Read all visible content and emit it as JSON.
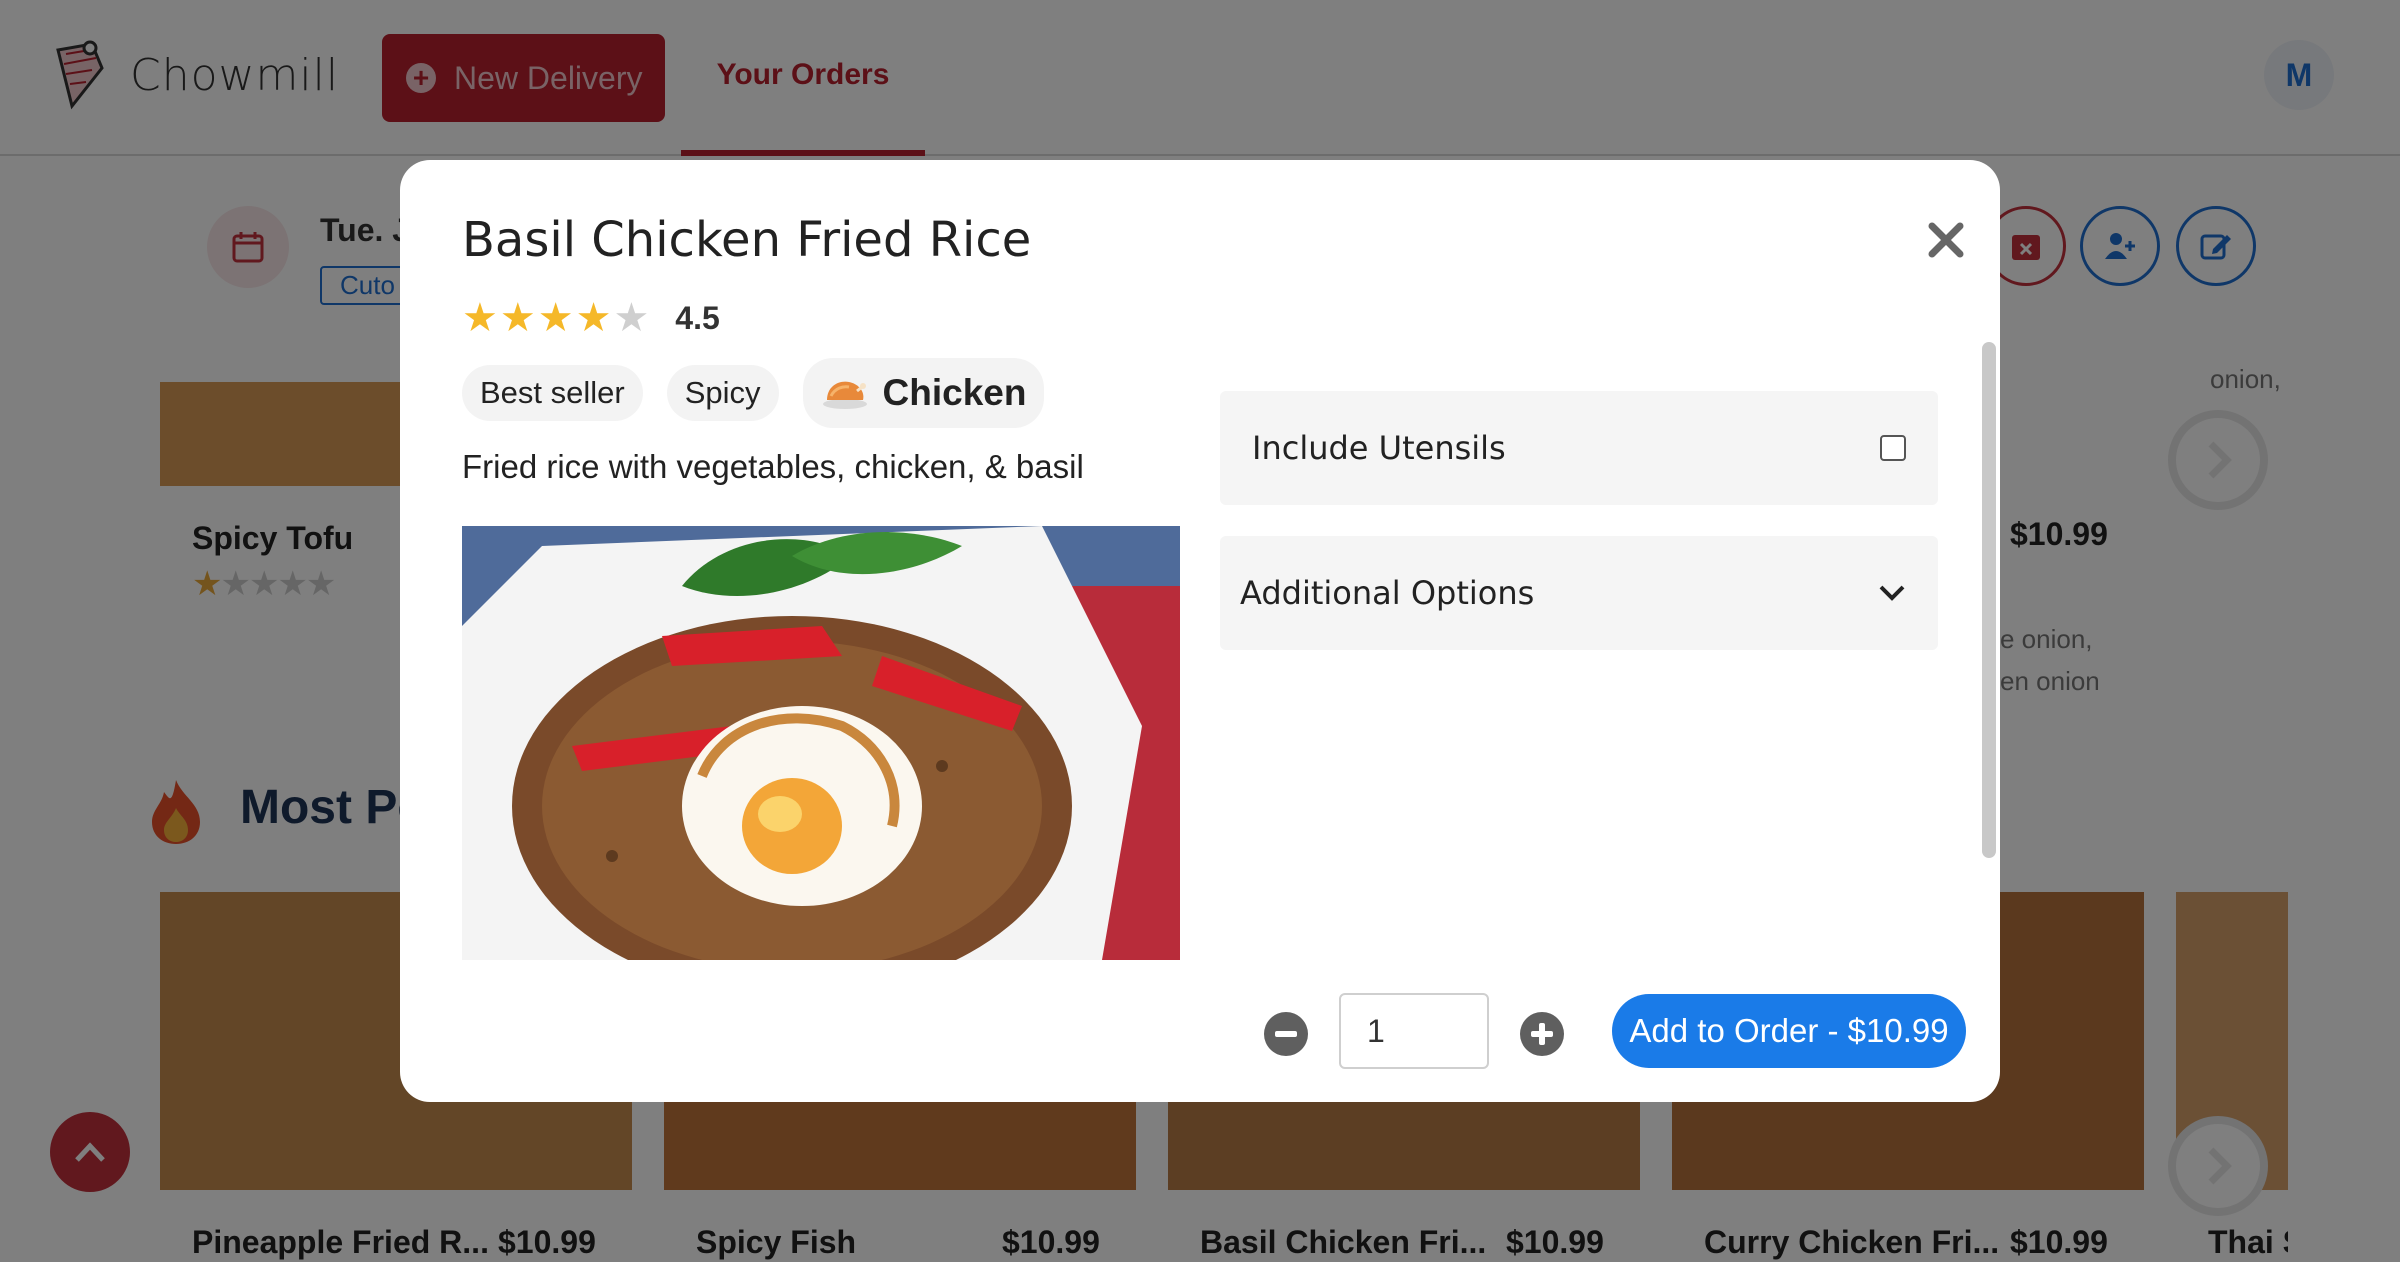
{
  "app": {
    "name": "Chowmill"
  },
  "nav": {
    "new_delivery": "New Delivery",
    "your_orders": "Your Orders",
    "user_initial": "M"
  },
  "delivery": {
    "date": "Tue. J",
    "cutoff": "Cuto"
  },
  "background": {
    "section_title": "Most Po",
    "top_card": {
      "title": "Spicy Tofu",
      "rating_filled": 1,
      "rating_max": 5
    },
    "right_card": {
      "price": "$10.99",
      "text_top": "onion,",
      "text_1": "e onion,",
      "text_2": "en onion"
    },
    "cards": [
      {
        "title": "Pineapple Fried R...",
        "price": "$10.99"
      },
      {
        "title": "Spicy Fish",
        "price": "$10.99"
      },
      {
        "title": "Basil Chicken Fri...",
        "price": "$10.99"
      },
      {
        "title": "Curry Chicken Fri...",
        "price": "$10.99"
      },
      {
        "title": "Thai S",
        "price": ""
      }
    ]
  },
  "modal": {
    "title": "Basil Chicken Fried Rice",
    "rating": "4.5",
    "rating_stars_filled": 4,
    "rating_stars_max": 5,
    "tags": [
      "Best seller",
      "Spicy"
    ],
    "protein_tag": "Chicken",
    "description": "Fried rice with vegetables, chicken, & basil",
    "options": {
      "utensils_label": "Include Utensils",
      "additional_label": "Additional Options"
    },
    "quantity": "1",
    "add_button": "Add to Order - $10.99"
  },
  "colors": {
    "brand_red": "#b8202f",
    "primary_blue": "#1a7be8",
    "star": "#f5b829"
  }
}
